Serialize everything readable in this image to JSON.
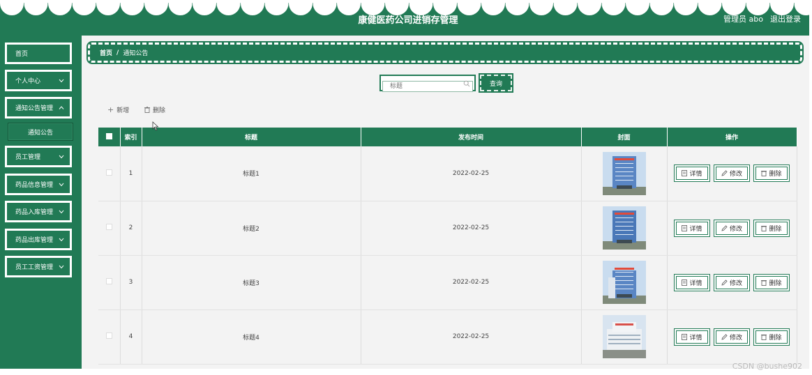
{
  "header": {
    "title": "康健医药公司进销存管理",
    "admin_label": "管理员 abo",
    "logout_label": "退出登录"
  },
  "sidebar": {
    "items": [
      {
        "label": "首页",
        "has_arrow": false
      },
      {
        "label": "个人中心",
        "has_arrow": true
      },
      {
        "label": "通知公告管理",
        "has_arrow": true
      },
      {
        "label": "通知公告",
        "sub": true
      },
      {
        "label": "员工管理",
        "has_arrow": true
      },
      {
        "label": "药品信息管理",
        "has_arrow": true
      },
      {
        "label": "药品入库管理",
        "has_arrow": true
      },
      {
        "label": "药品出库管理",
        "has_arrow": true
      },
      {
        "label": "员工工资管理",
        "has_arrow": true
      }
    ]
  },
  "breadcrumb": {
    "home": "首页",
    "separator": "/",
    "current": "通知公告"
  },
  "search": {
    "placeholder": "标题",
    "button_label": "查询"
  },
  "toolbar": {
    "add_label": "新增",
    "delete_label": "删除"
  },
  "table": {
    "headers": {
      "index": "索引",
      "title": "标题",
      "date": "发布时间",
      "cover": "封面",
      "actions": "操作"
    },
    "rows": [
      {
        "index": "1",
        "title": "标题1",
        "date": "2022-02-25",
        "cover": "building-photo"
      },
      {
        "index": "2",
        "title": "标题2",
        "date": "2022-02-25",
        "cover": "building-photo"
      },
      {
        "index": "3",
        "title": "标题3",
        "date": "2022-02-25",
        "cover": "building-photo"
      },
      {
        "index": "4",
        "title": "标题4",
        "date": "2022-02-25",
        "cover": "building-photo"
      }
    ],
    "actions": {
      "detail_label": "详情",
      "edit_label": "修改",
      "delete_label": "删除"
    }
  },
  "watermark": "CSDN @bushe902",
  "colors": {
    "brand": "#217a55",
    "background": "#f3f3f3"
  }
}
